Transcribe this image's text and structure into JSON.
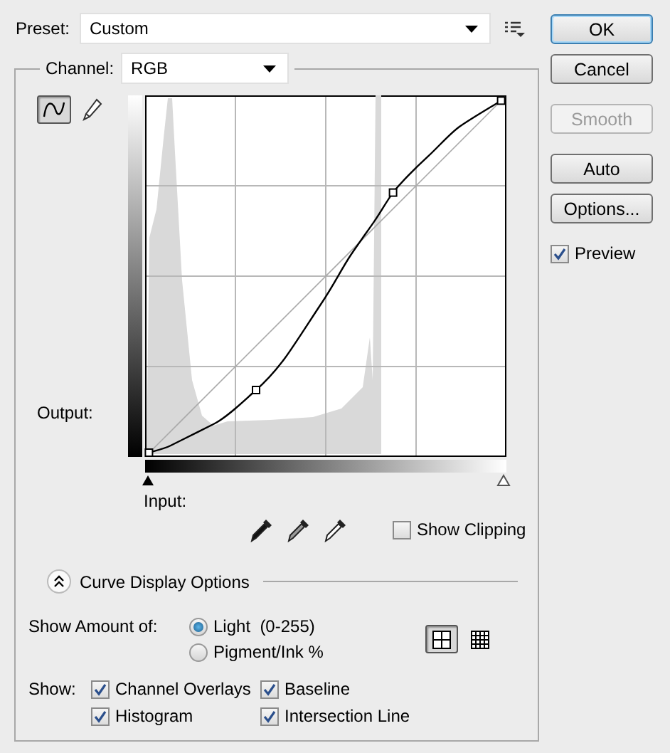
{
  "preset": {
    "label": "Preset:",
    "value": "Custom"
  },
  "buttons": [
    {
      "label": "OK",
      "default": true,
      "disabled": false
    },
    {
      "label": "Cancel",
      "default": false,
      "disabled": false
    },
    {
      "label": "Smooth",
      "default": false,
      "disabled": true
    },
    {
      "label": "Auto",
      "default": false,
      "disabled": false
    },
    {
      "label": "Options...",
      "default": false,
      "disabled": false
    }
  ],
  "preview": {
    "label": "Preview",
    "checked": true
  },
  "channel": {
    "label": "Channel:",
    "value": "RGB"
  },
  "tools": [
    {
      "kind": "curve",
      "selected": true
    },
    {
      "kind": "pencil",
      "selected": false
    }
  ],
  "graph": {
    "output_label": "Output:",
    "input_label": "Input:"
  },
  "show_clipping": {
    "label": "Show Clipping",
    "checked": false
  },
  "curve_display_options": {
    "title": "Curve Display Options",
    "expanded": true
  },
  "show_amount": {
    "label": "Show Amount of:",
    "options": [
      {
        "label": "Light  (0-255)",
        "selected": true
      },
      {
        "label": "Pigment/Ink %",
        "selected": false
      }
    ]
  },
  "grid_sizes": [
    {
      "kind": "simple",
      "selected": true
    },
    {
      "kind": "detailed",
      "selected": false
    }
  ],
  "show": {
    "label": "Show:",
    "options": [
      {
        "label": "Channel Overlays",
        "checked": true
      },
      {
        "label": "Baseline",
        "checked": true
      },
      {
        "label": "Histogram",
        "checked": true
      },
      {
        "label": "Intersection Line",
        "checked": true
      }
    ]
  }
}
